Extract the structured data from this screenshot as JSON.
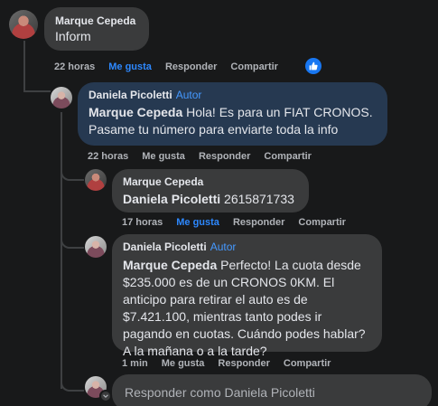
{
  "comment_main": {
    "author": "Marque Cepeda",
    "text": "Inform",
    "time": "22 horas",
    "like_label": "Me gusta",
    "reply_label": "Responder",
    "share_label": "Compartir",
    "reaction_icon": "thumbs-up-icon"
  },
  "reply_1": {
    "author": "Daniela Picoletti",
    "badge": "Autor",
    "mention": "Marque Cepeda",
    "text": "Hola! Es para un FIAT CRONOS. Pasame tu número para enviarte toda la info",
    "time": "22 horas",
    "like_label": "Me gusta",
    "reply_label": "Responder",
    "share_label": "Compartir"
  },
  "reply_2": {
    "author": "Marque Cepeda",
    "mention": "Daniela Picoletti",
    "text": "2615871733",
    "time": "17 horas",
    "like_label": "Me gusta",
    "reply_label": "Responder",
    "share_label": "Compartir"
  },
  "reply_3": {
    "author": "Daniela Picoletti",
    "badge": "Autor",
    "mention": "Marque Cepeda",
    "text": "Perfecto! La cuota desde $235.000 es de un CRONOS 0KM. El anticipo para retirar el auto es de $7.421.100, mientras tanto podes ir pagando en cuotas. Cuándo podes hablar? A la mañana o a la tarde?",
    "time": "1 min",
    "like_label": "Me gusta",
    "reply_label": "Responder",
    "share_label": "Compartir"
  },
  "reply_box": {
    "placeholder": "Responder como Daniela Picoletti"
  },
  "colors": {
    "background": "#18191a",
    "bubble": "#3a3b3c",
    "author_bubble": "#263951",
    "link_blue": "#2d88ff",
    "muted_text": "#b0b3b8"
  }
}
